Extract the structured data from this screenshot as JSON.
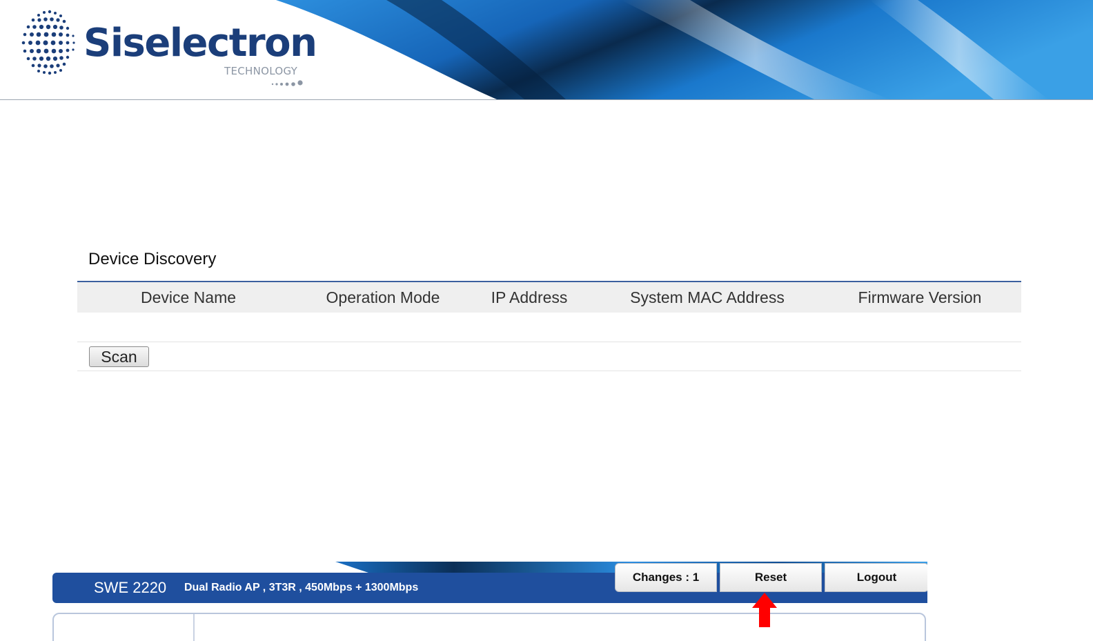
{
  "banner": {
    "brand_name": "Siselectron",
    "brand_tagline": "TECHNOLOGY",
    "colors": {
      "brand_blue": "#1b3e7a",
      "swoosh_light": "#3aa0e6",
      "swoosh_dark": "#0a2a4d"
    },
    "icons": {
      "logo": "globe-dots-icon"
    }
  },
  "discovery": {
    "title": "Device Discovery",
    "columns": [
      "Device Name",
      "Operation Mode",
      "IP Address",
      "System MAC Address",
      "Firmware Version"
    ],
    "rows": [],
    "scan_label": "Scan"
  },
  "device_ui": {
    "model": "SWE 2220",
    "description": "Dual Radio AP , 3T3R , 450Mbps + 1300Mbps",
    "buttons": {
      "changes": "Changes : 1",
      "reset": "Reset",
      "logout": "Logout"
    },
    "colors": {
      "nav_blue": "#1f4f9e",
      "highlight_arrow": "#ff0000"
    },
    "icons": {
      "pointer": "red-up-arrow-icon"
    }
  }
}
